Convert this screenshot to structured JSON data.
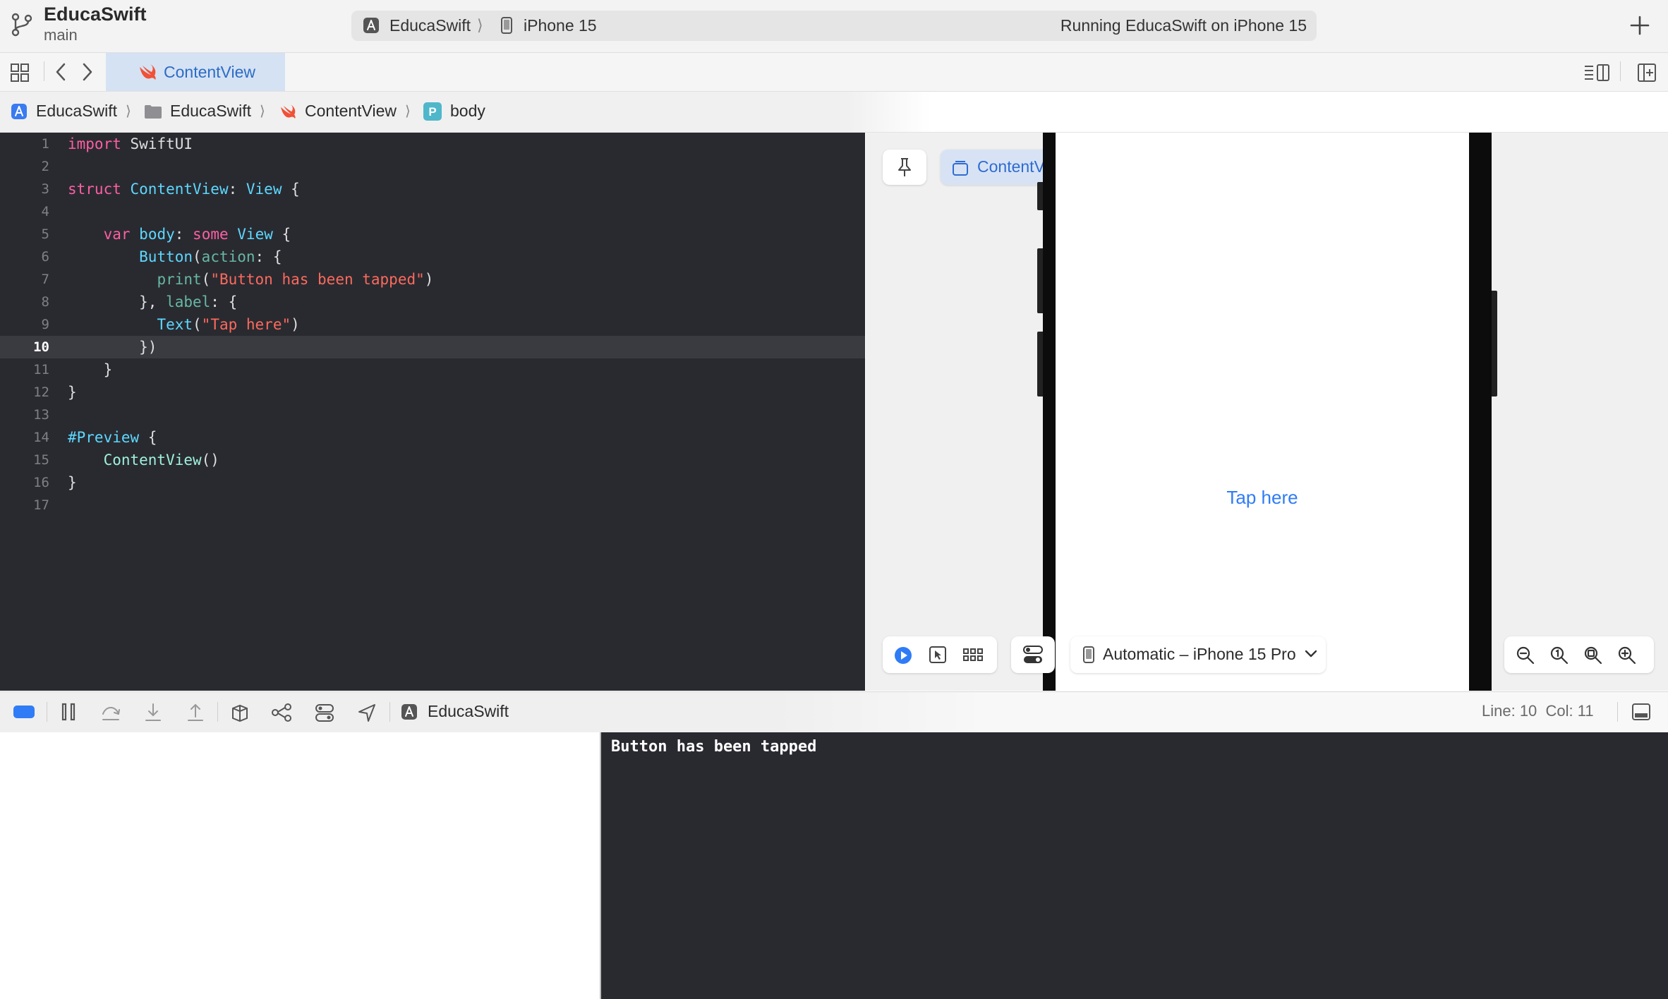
{
  "project": {
    "name": "EducaSwift",
    "branch": "main"
  },
  "activity": {
    "scheme": "EducaSwift",
    "separator": "⟩",
    "destination": "iPhone 15",
    "status": "Running EducaSwift on iPhone 15"
  },
  "tabs": [
    {
      "label": "ContentView",
      "active": true
    }
  ],
  "breadcrumb": [
    {
      "label": "EducaSwift",
      "icon": "app-icon"
    },
    {
      "label": "EducaSwift",
      "icon": "folder-icon"
    },
    {
      "label": "ContentView",
      "icon": "swift-icon"
    },
    {
      "label": "body",
      "icon": "property-icon"
    }
  ],
  "breadcrumb_sep": "⟩",
  "editor": {
    "current_line": 10,
    "lines": [
      {
        "n": "1"
      },
      {
        "n": "2"
      },
      {
        "n": "3"
      },
      {
        "n": "4"
      },
      {
        "n": "5"
      },
      {
        "n": "6"
      },
      {
        "n": "7"
      },
      {
        "n": "8"
      },
      {
        "n": "9"
      },
      {
        "n": "10"
      },
      {
        "n": "11"
      },
      {
        "n": "12"
      },
      {
        "n": "13"
      },
      {
        "n": "14"
      },
      {
        "n": "15"
      },
      {
        "n": "16"
      },
      {
        "n": "17"
      }
    ]
  },
  "code": {
    "l1_kw": "import",
    "l1_mod": "SwiftUI",
    "l3_kw": "struct",
    "l3_name": "ContentView",
    "l3_type": "View",
    "l5_var": "var",
    "l5_body": "body",
    "l5_some": "some",
    "l5_type": "View",
    "l6_fn": "Button",
    "l6_arg": "action",
    "l7_fn": "print",
    "l7_str": "\"Button has been tapped\"",
    "l8_arg": "label",
    "l9_fn": "Text",
    "l9_str": "\"Tap here\"",
    "l14_macro": "#Preview",
    "l15_call": "ContentView"
  },
  "preview": {
    "chip_label": "ContentView",
    "button_text": "Tap here",
    "device": "Automatic – iPhone 15 Pro"
  },
  "debug": {
    "scheme": "EducaSwift",
    "cursor_line": "Line: 10",
    "cursor_col": "Col: 11"
  },
  "console": {
    "output": "Button has been tapped"
  },
  "colors": {
    "accent": "#2f7cf6",
    "editor_bg": "#292a30",
    "keyword": "#fc5fa3",
    "type": "#5dd8ff",
    "string": "#fc6a5d"
  }
}
